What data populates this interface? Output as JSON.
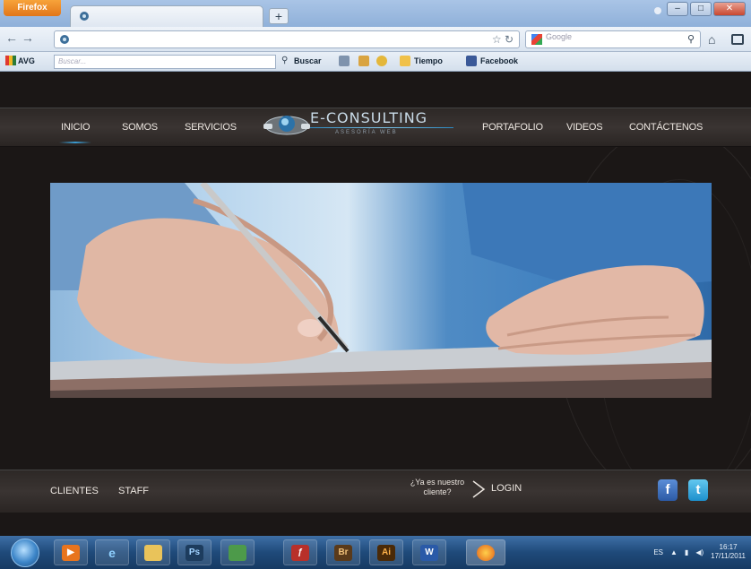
{
  "browser": {
    "firefox_label": "Firefox",
    "new_tab_symbol": "+",
    "search_engine_placeholder": "Google",
    "toolbar": {
      "avg_label": "AVG",
      "avg_search_placeholder": "Buscar...",
      "search_button": "Buscar",
      "weather": "Tiempo",
      "facebook": "Facebook"
    }
  },
  "site": {
    "nav_left": [
      "INICIO",
      "SOMOS",
      "SERVICIOS"
    ],
    "nav_right": [
      "PORTAFOLIO",
      "VIDEOS",
      "CONTÁCTENOS"
    ],
    "logo_name": "E-CONSULTING",
    "logo_tagline": "ASESORÍA WEB",
    "footer_links": [
      "CLIENTES",
      "STAFF"
    ],
    "client_question_line1": "¿Ya es nuestro",
    "client_question_line2": "cliente?",
    "login": "LOGIN",
    "social_fb": "f",
    "social_tw": "t"
  },
  "taskbar": {
    "apps": [
      "Ps",
      "Br",
      "Ai",
      "W"
    ],
    "language": "ES",
    "time": "16:17",
    "date": "17/11/2011"
  },
  "colors": {
    "accent_blue": "#3a9bd1",
    "site_bg": "#1b1716",
    "taskbar": "#1f4a7a"
  }
}
